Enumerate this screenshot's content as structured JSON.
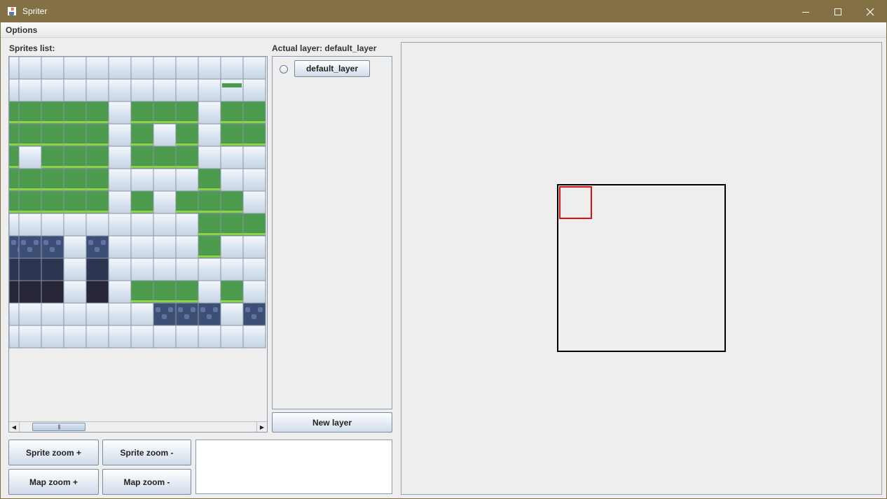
{
  "window": {
    "title": "Spriter",
    "icon": "java-cup-icon",
    "title_bar_color": "#837045"
  },
  "menu": {
    "options_label": "Options"
  },
  "sprites": {
    "label": "Sprites list:",
    "scroll_left_glyph": "◀",
    "scroll_right_glyph": "▶",
    "scroll_thumb_grip": "|||"
  },
  "layers": {
    "actual_label": "Actual layer: default_layer",
    "items": [
      {
        "label": "default_layer",
        "selected": false
      }
    ],
    "new_layer_label": "New layer"
  },
  "controls": {
    "sprite_zoom_plus": "Sprite zoom +",
    "sprite_zoom_minus": "Sprite zoom -",
    "map_zoom_plus": "Map zoom +",
    "map_zoom_minus": "Map zoom -"
  },
  "colors": {
    "grass": "#4c9a4e",
    "grass_tuft": "#8fd14a",
    "stone": "#3d4f74",
    "dark": "#262636",
    "empty_tile": "#dde7f1",
    "grid_line": "#8597a8",
    "map_cursor": "#e01010"
  }
}
